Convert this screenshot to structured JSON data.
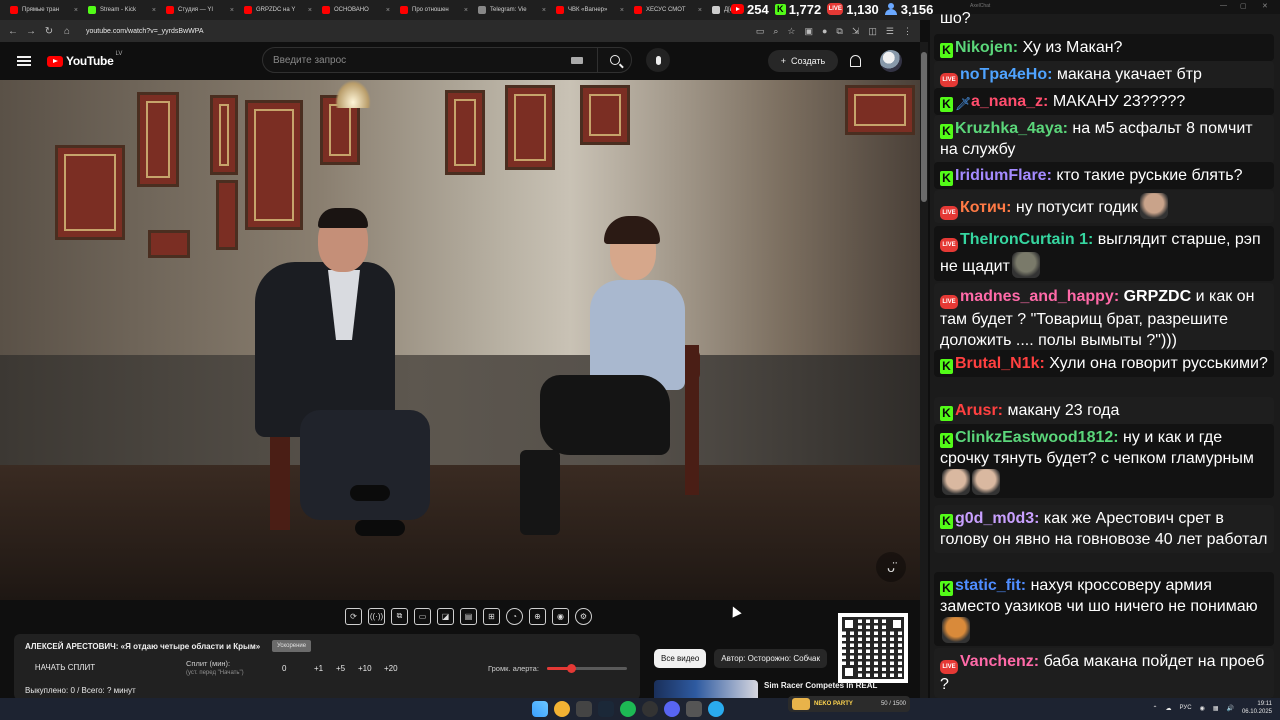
{
  "browser": {
    "tabs": [
      {
        "label": "Прямые тран",
        "color": "#ff0000"
      },
      {
        "label": "Stream - Kick",
        "color": "#53fc18"
      },
      {
        "label": "Студия — YI",
        "color": "#ff0000"
      },
      {
        "label": "GRPZDC на Y",
        "color": "#ff0000"
      },
      {
        "label": "ОСНОВАНО",
        "color": "#ff0000"
      },
      {
        "label": "Про отношен",
        "color": "#ff0000"
      },
      {
        "label": "Telegram: Vie",
        "color": "#888888"
      },
      {
        "label": "ЧВК «Вагнер»",
        "color": "#ff0000"
      },
      {
        "label": "ХЕСУС СМОТ",
        "color": "#ff0000"
      },
      {
        "label": "Д[ы]ра",
        "color": "#cccccc"
      }
    ],
    "url": "youtube.com/watch?v=_yyrdsBwWPA",
    "nav": [
      "←",
      "→",
      "↻",
      "⌂"
    ],
    "addr_icons": [
      "▭",
      "⌕",
      "☆",
      "▣",
      "●",
      "⧉",
      "⇲",
      "◫",
      "☰",
      "⋮"
    ]
  },
  "stats": {
    "youtube": "254",
    "kick": "1,772",
    "live": "1,130",
    "total": "3,156",
    "live_label": "LIVE"
  },
  "youtube": {
    "logo_text": "YouTube",
    "region": "LV",
    "search_placeholder": "Введите запрос",
    "create_label": "Создать",
    "create_icon": "+"
  },
  "video": {
    "logo": "ᴗ̈"
  },
  "toolbar": {
    "icons": [
      "⟳",
      "((·))",
      "⧉",
      "▭",
      "◪",
      "▤",
      "⊞",
      "◔",
      "⊕",
      "◉",
      "⚙"
    ]
  },
  "split": {
    "title": "АЛЕКСЕЙ АРЕСТОВИЧ: «Я отдаю четыре области и Крым»",
    "badge": "Ускорение",
    "start_label": "НАЧАТЬ СПЛИТ",
    "split_label": "Сплит (мин):",
    "split_sub": "(уст. перед \"Начать\")",
    "values": [
      "0",
      "+1",
      "+5",
      "+10",
      "+20"
    ],
    "volume_label": "Громк. алерта:",
    "volume_level": 0.3,
    "bought": "Выкуплено: 0 / Всего: ? минут"
  },
  "chips": [
    "Все видео",
    "Автор: Осторожно: Собчак"
  ],
  "recommended": {
    "title": "Sim Racer Competes In REAL"
  },
  "chat": {
    "app_title": "AxelChat",
    "top_partial": "шо?",
    "messages": [
      {
        "badge": "kick",
        "nick": "Nikojen:",
        "color": "#5bd67a",
        "text": " Ху из Макан?"
      },
      {
        "badge": "live",
        "nick": "noTpa4eHo:",
        "color": "#4fa3ff",
        "text": " макана укачает бтр"
      },
      {
        "badge": "kick",
        "badge2": "sword",
        "nick": "a_nana_z:",
        "color": "#ff4d6d",
        "text": " МАКАНУ 23?????"
      },
      {
        "badge": "kick",
        "nick": "Kruzhka_4aya:",
        "color": "#5bd67a",
        "text": " на м5 асфальт 8 помчит на службу"
      },
      {
        "badge": "kick",
        "nick": "IridiumFlare:",
        "color": "#a58bff",
        "text": " кто такие руськие блять?"
      },
      {
        "badge": "live",
        "nick": "Котич:",
        "color": "#ff7a45",
        "text": " ну потусит годик"
      },
      {
        "badge": "live",
        "nick": "TheIronCurtain 1:",
        "color": "#36d6a0",
        "text": " выглядит старше, рэп не щадит"
      },
      {
        "badge": "live",
        "nick": "madnes_and_happy:",
        "color": "#ff6aa8",
        "mention": " GRPZDC",
        "text": " и как он там будет ? \"Товарищ брат, разрешите доложить .... полы вымыты ?\")))"
      },
      {
        "badge": "kick",
        "nick": "Brutal_N1k:",
        "color": "#ff4040",
        "text": " Хули она говорит русськими?"
      },
      {
        "badge": "kick",
        "nick": "Arusr:",
        "color": "#ff4040",
        "text": " макану 23 года"
      },
      {
        "badge": "kick",
        "nick": "ClinkzEastwood1812:",
        "color": "#5bd67a",
        "text": " ну и как и где срочку тянуть будет? с чепком гламурным"
      },
      {
        "badge": "kick",
        "nick": "g0d_m0d3:",
        "color": "#c9a0ff",
        "text": " как же Арестович срет в голову он явно на говновозе 40 лет работал"
      },
      {
        "badge": "kick",
        "nick": "static_fit:",
        "color": "#4f8dff",
        "text": " нахуя кроссоверу армия заместо уазиков чи шо ничего не понимаю"
      },
      {
        "badge": "live",
        "nick": "Vanchenz:",
        "color": "#ff6aa8",
        "text": " баба макана пойдет на проеб ?"
      }
    ]
  },
  "float_widget": {
    "name": "NEKO PARTY",
    "count": "50 / 1500"
  },
  "taskbar": {
    "lang": "РУС",
    "time": "19:11",
    "date": "06.10.2025",
    "tray_icons": [
      "⌃",
      "☁",
      "⌨",
      "◉",
      "▦",
      "🔊"
    ]
  }
}
